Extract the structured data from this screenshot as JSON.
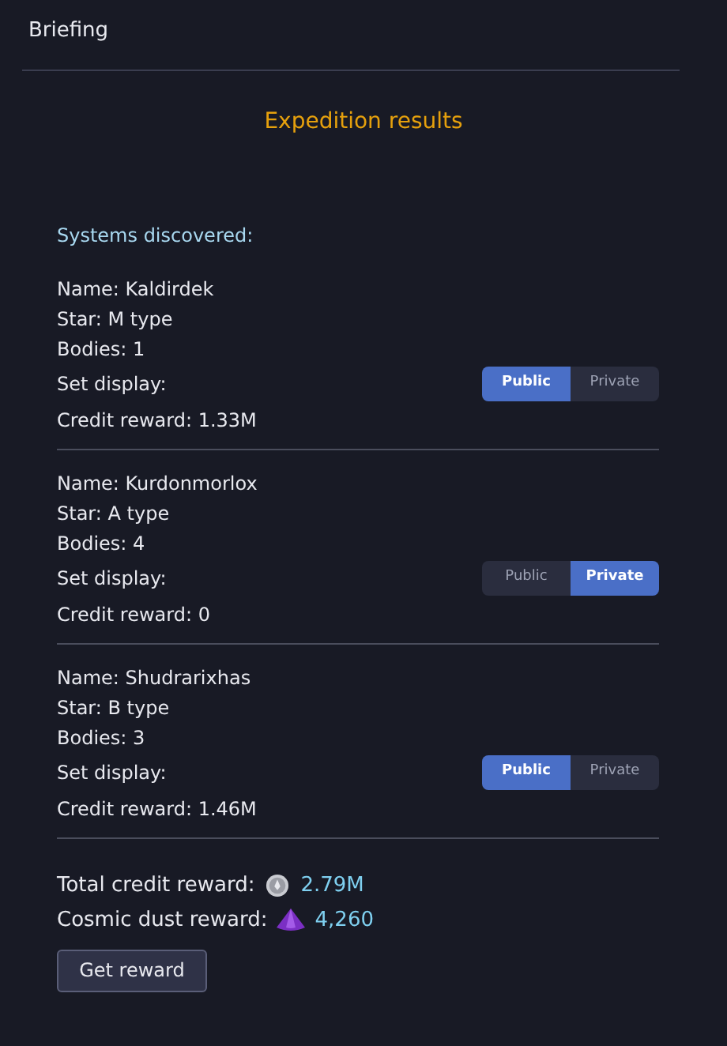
{
  "header": {
    "title": "Briefing"
  },
  "title": "Expedition results",
  "systems_heading": "Systems discovered:",
  "systems": [
    {
      "name": "Name: Kaldirdek",
      "star": "Star: M type",
      "bodies": "Bodies: 1",
      "display_label": "Set display:",
      "options": [
        {
          "label": "Public",
          "selected": true
        },
        {
          "label": "Private",
          "selected": false
        }
      ],
      "credit": "Credit reward: 1.33M"
    },
    {
      "name": "Name: Kurdonmorlox",
      "star": "Star: A type",
      "bodies": "Bodies: 4",
      "display_label": "Set display:",
      "options": [
        {
          "label": "Public",
          "selected": false
        },
        {
          "label": "Private",
          "selected": true
        }
      ],
      "credit": "Credit reward: 0"
    },
    {
      "name": "Name: Shudrarixhas",
      "star": "Star: B type",
      "bodies": "Bodies: 3",
      "display_label": "Set display:",
      "options": [
        {
          "label": "Public",
          "selected": true
        },
        {
          "label": "Private",
          "selected": false
        }
      ],
      "credit": "Credit reward: 1.46M"
    }
  ],
  "totals": [
    {
      "kind": "credit",
      "label": "Total credit reward:",
      "value": "2.79M"
    },
    {
      "kind": "dust",
      "label": "Cosmic dust reward:",
      "value": "4,260"
    }
  ],
  "button": "Get reward"
}
